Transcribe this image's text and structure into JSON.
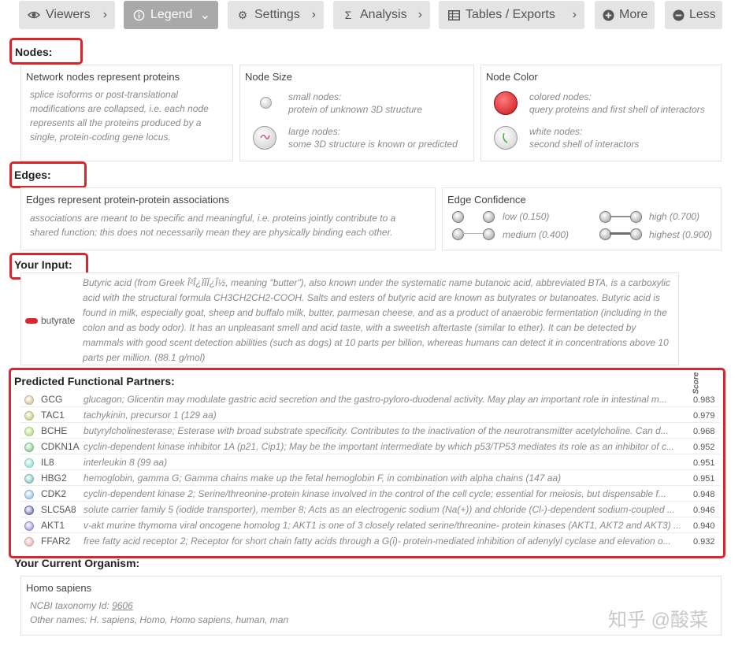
{
  "toolbar": {
    "viewers": "Viewers",
    "legend": "Legend",
    "settings": "Settings",
    "analysis": "Analysis",
    "tables": "Tables / Exports",
    "more": "More",
    "less": "Less"
  },
  "nodes": {
    "heading": "Nodes:",
    "box1_title": "Network nodes represent proteins",
    "box1_text": "splice isoforms or post-translational modifications are collapsed, i.e. each node represents all the proteins produced by a single, protein-coding gene locus.",
    "size_title": "Node Size",
    "small_label": "small nodes:",
    "small_desc": "protein of unknown 3D structure",
    "large_label": "large nodes:",
    "large_desc": "some 3D structure is known or predicted",
    "color_title": "Node Color",
    "colored_label": "colored nodes:",
    "colored_desc": "query proteins and first shell of interactors",
    "white_label": "white nodes:",
    "white_desc": "second shell of interactors"
  },
  "edges": {
    "heading": "Edges:",
    "box_title": "Edges represent protein-protein associations",
    "box_text": "associations are meant to be specific and meaningful, i.e. proteins jointly contribute to a shared function; this does not necessarily mean they are physically binding each other.",
    "conf_title": "Edge Confidence",
    "low": "low (0.150)",
    "medium": "medium (0.400)",
    "high": "high (0.700)",
    "highest": "highest (0.900)"
  },
  "input": {
    "heading": "Your Input:",
    "name": "butyrate",
    "color": "#d9262c",
    "description": "Butyric acid (from Greek Î²Î¿ÏÏÏ¿Î½, meaning \"butter\"), also known under the systematic name butanoic acid, abbreviated BTA, is a carboxylic acid with the structural formula CH3CH2CH2-COOH. Salts and esters of butyric acid are known as butyrates or butanoates. Butyric acid is found in milk, especially goat, sheep and buffalo milk, butter, parmesan cheese, and as a product of anaerobic fermentation (including in the colon and as body odor). It has an unpleasant smell and acid taste, with a sweetish aftertaste (similar to ether). It can be detected by mammals with good scent detection abilities (such as dogs) at 10 parts per billion, whereas humans can detect it in concentrations above 10 parts per million. (88.1 g/mol)"
  },
  "partners": {
    "heading": "Predicted Functional Partners:",
    "score_label": "Score",
    "rows": [
      {
        "gene": "GCG",
        "color": "#c8b48c",
        "desc": "glucagon; Glicentin may modulate gastric acid secretion and the gastro-pyloro-duodenal activity. May play an important role in intestinal m...",
        "score": "0.983"
      },
      {
        "gene": "TAC1",
        "color": "#b8c070",
        "desc": "tachykinin, precursor 1 (129 aa)",
        "score": "0.979"
      },
      {
        "gene": "BCHE",
        "color": "#a6cf72",
        "desc": "butyrylcholinesterase; Esterase with broad substrate specificity. Contributes to the inactivation of the neurotransmitter acetylcholine. Can d...",
        "score": "0.968"
      },
      {
        "gene": "CDKN1A",
        "color": "#6ec07a",
        "desc": "cyclin-dependent kinase inhibitor 1A (p21, Cip1); May be the important intermediate by which p53/TP53 mediates its role as an inhibitor of c...",
        "score": "0.952"
      },
      {
        "gene": "IL8",
        "color": "#7fd3c4",
        "desc": "interleukin 8 (99 aa)",
        "score": "0.951"
      },
      {
        "gene": "HBG2",
        "color": "#6fb9b0",
        "desc": "hemoglobin, gamma G; Gamma chains make up the fetal hemoglobin F, in combination with alpha chains (147 aa)",
        "score": "0.951"
      },
      {
        "gene": "CDK2",
        "color": "#86b3d6",
        "desc": "cyclin-dependent kinase 2; Serine/threonine-protein kinase involved in the control of the cell cycle; essential for meiosis, but dispensable f...",
        "score": "0.948"
      },
      {
        "gene": "SLC5A8",
        "color": "#5d5fa8",
        "desc": "solute carrier family 5 (iodide transporter), member 8; Acts as an electrogenic sodium (Na(+)) and chloride (Cl-)-dependent sodium-coupled ...",
        "score": "0.946"
      },
      {
        "gene": "AKT1",
        "color": "#8e86cc",
        "desc": "v-akt murine thymoma viral oncogene homolog 1; AKT1 is one of 3 closely related serine/threonine- protein kinases (AKT1, AKT2 and AKT3) ...",
        "score": "0.940"
      },
      {
        "gene": "FFAR2",
        "color": "#d9a0a6",
        "desc": "free fatty acid receptor 2; Receptor for short chain fatty acids through a G(i)- protein-mediated inhibition of adenylyl cyclase and elevation o...",
        "score": "0.932"
      }
    ]
  },
  "organism": {
    "heading": "Your Current Organism:",
    "name": "Homo sapiens",
    "taxonomy_prefix": "NCBI taxonomy Id:",
    "taxonomy_id": "9606",
    "other_names": "Other names: H. sapiens, Homo, Homo sapiens, human, man"
  },
  "watermark": "知乎 @酸菜"
}
